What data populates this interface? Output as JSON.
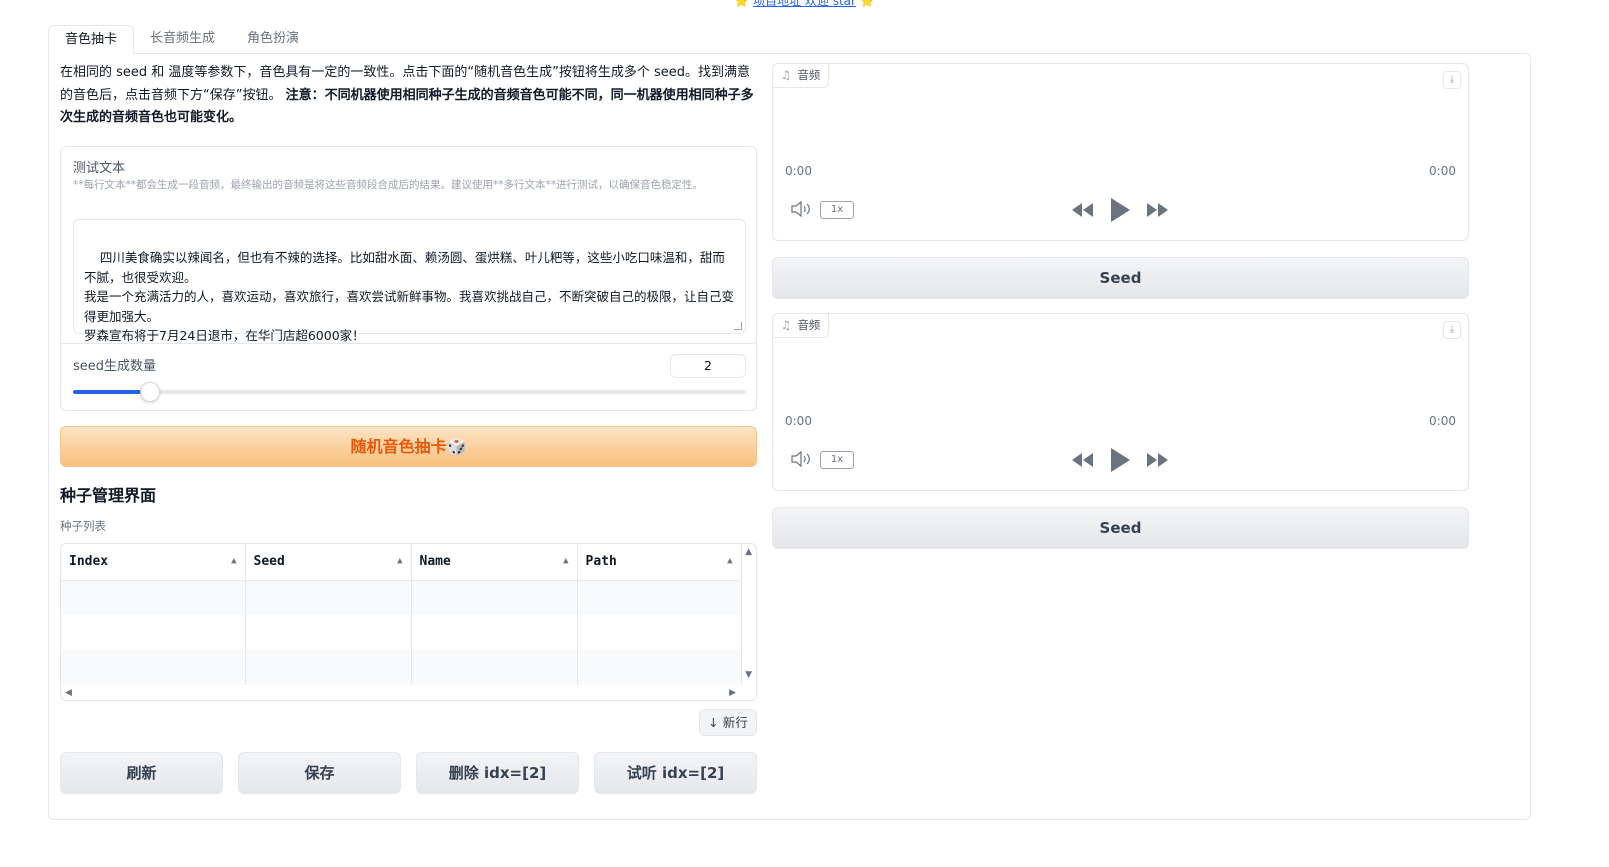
{
  "topbar": {
    "star_left": "⭐",
    "link_text": "项目地址 欢迎 star",
    "star_right": "⭐"
  },
  "tabs": [
    {
      "label": "音色抽卡",
      "active": true
    },
    {
      "label": "长音频生成",
      "active": false
    },
    {
      "label": "角色扮演",
      "active": false
    }
  ],
  "intro": {
    "text": "在相同的 seed 和 温度等参数下，音色具有一定的一致性。点击下面的“随机音色生成”按钮将生成多个 seed。找到满意的音色后，点击音频下方“保存”按钮。",
    "bold": "注意：不同机器使用相同种子生成的音频音色可能不同，同一机器使用相同种子多次生成的音频音色也可能变化。"
  },
  "test_text": {
    "label": "测试文本",
    "info": "**每行文本**都会生成一段音频，最终输出的音频是将这些音频段合成后的结果。建议使用**多行文本**进行测试，以确保音色稳定性。",
    "value": "四川美食确实以辣闻名，但也有不辣的选择。比如甜水面、赖汤圆、蛋烘糕、叶儿粑等，这些小吃口味温和，甜而不腻，也很受欢迎。\n我是一个充满活力的人，喜欢运动，喜欢旅行，喜欢尝试新鲜事物。我喜欢挑战自己，不断突破自己的极限，让自己变得更加强大。\n罗森宣布将于7月24日退市，在华门店超6000家！"
  },
  "seed_count": {
    "label": "seed生成数量",
    "value": "2",
    "fraction": 0.115
  },
  "random_button": "随机音色抽卡🎲",
  "seed_manager": {
    "title": "种子管理界面",
    "list_label": "种子列表",
    "columns": [
      "Index",
      "Seed",
      "Name",
      "Path"
    ],
    "rows": [
      [
        "",
        "",
        "",
        ""
      ],
      [
        "",
        "",
        "",
        ""
      ],
      [
        "",
        "",
        "",
        ""
      ]
    ],
    "new_row": "↓ 新行"
  },
  "actions": {
    "refresh": "刷新",
    "save": "保存",
    "delete": "删除 idx=[2]",
    "listen": "试听 idx=[2]"
  },
  "audio_players": [
    {
      "label": "音频",
      "time_start": "0:00",
      "time_end": "0:00",
      "rate": "1x",
      "seed_button": "Seed"
    },
    {
      "label": "音频",
      "time_start": "0:00",
      "time_end": "0:00",
      "rate": "1x",
      "seed_button": "Seed"
    }
  ],
  "colors": {
    "accent_blue": "#2563eb",
    "primary_text": "#ea580c",
    "primary_bg": "#f8c07f"
  }
}
